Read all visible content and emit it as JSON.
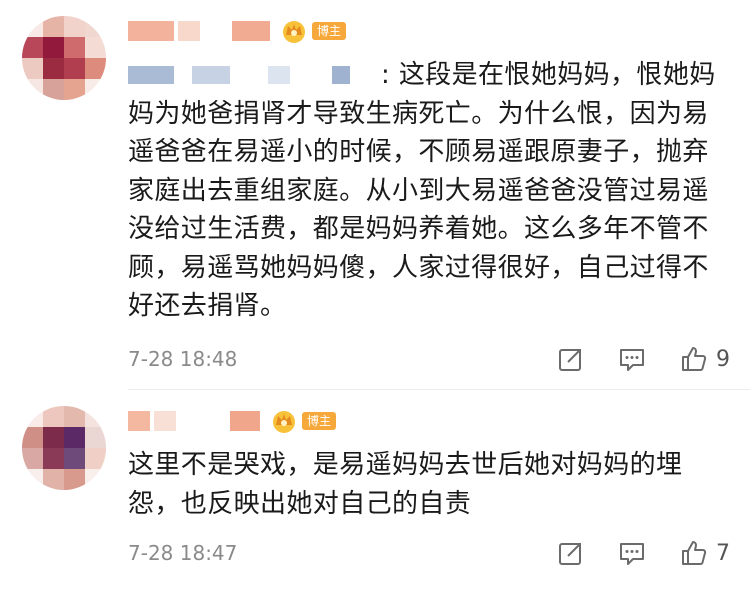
{
  "comments": [
    {
      "avatar_colors": [
        "#f8e9e6",
        "#e6b4a6",
        "#f1d3cc",
        "#f0d7d0",
        "#b8475a",
        "#92183c",
        "#cf6b6c",
        "#f4dcd5",
        "#eccac2",
        "#9b2b40",
        "#b03e4e",
        "#dd8b7c",
        "#f6e7e3",
        "#d6a299",
        "#e4a48f",
        "#f8ece8"
      ],
      "name_blocks": [
        "#f0a98e",
        "#f4c9b7",
        "#f8d6c6",
        "#e8a08b"
      ],
      "badge": "博主",
      "reply_blocks": [
        "#9fb2cf",
        "#c6d2e4",
        "#d7e0ec",
        "#b5c5da"
      ],
      "text": ": 这段是在恨她妈妈，恨她妈妈为她爸捐肾才导致生病死亡。为什么恨，因为易遥爸爸在易遥小的时候，不顾易遥跟原妻子，抛弃家庭出去重组家庭。从小到大易遥爸爸没管过易遥没给过生活费，都是妈妈养着她。这么多年不管不顾，易遥骂她妈妈傻，人家过得很好，自己过得不好还去捐肾。",
      "timestamp": "7-28 18:48",
      "likes": "9"
    },
    {
      "avatar_colors": [
        "#f9ece8",
        "#edc7bd",
        "#e3b9ad",
        "#f3e2dd",
        "#cf8f86",
        "#7c2c4a",
        "#5b2a66",
        "#ead7d4",
        "#d9a8a4",
        "#8a3957",
        "#6e4a7a",
        "#efcfc6",
        "#f8efec",
        "#e0b2a8",
        "#d89a8d",
        "#f9efeb"
      ],
      "name_blocks": [
        "#f4b8a1",
        "#f8dcd0",
        "#f0a689",
        "#f6c7b4"
      ],
      "badge": "博主",
      "text": "这里不是哭戏，是易遥妈妈去世后她对妈妈的埋怨，也反映出她对自己的自责",
      "timestamp": "7-28 18:47",
      "likes": "7"
    }
  ],
  "icons": {
    "share": "share-icon",
    "comment": "comment-icon",
    "like": "thumbs-up-icon",
    "crown": "crown-icon"
  }
}
